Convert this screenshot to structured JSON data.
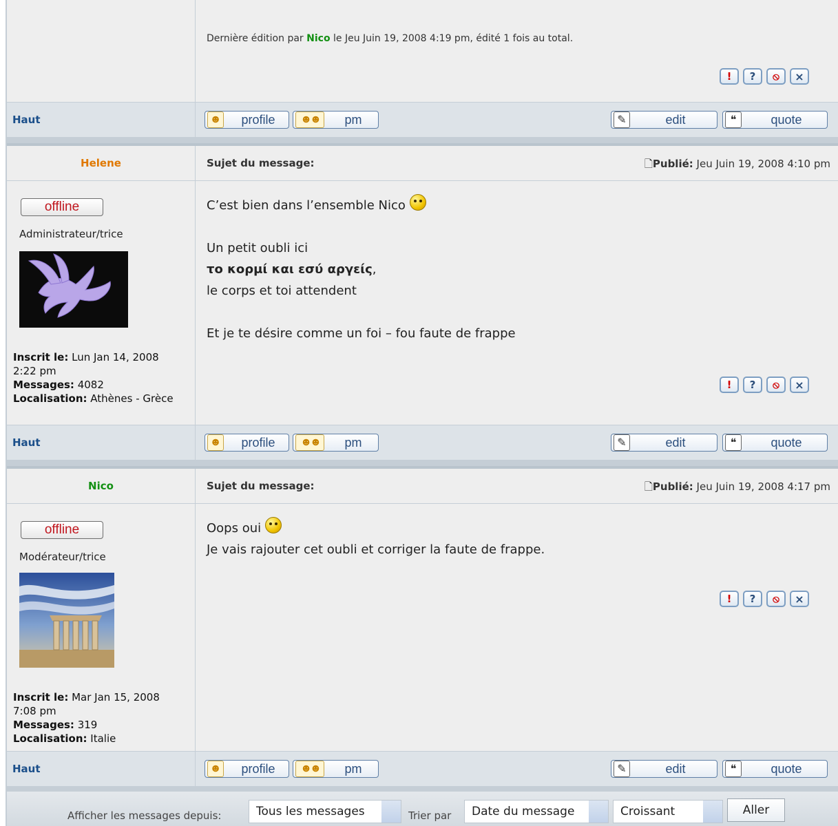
{
  "edit_note": {
    "prefix": "Dernière édition par",
    "author": "Nico",
    "suffix": "le Jeu Juin 19, 2008 4:19 pm, édité 1 fois au total."
  },
  "common": {
    "haut": "Haut",
    "subject_label": "Sujet du message:",
    "published_label": "Publié:",
    "offline_label": "offline",
    "profile_label": "profile",
    "pm_label": "pm",
    "edit_label": "edit",
    "quote_label": "quote",
    "registered_label": "Inscrit le:",
    "messages_label": "Messages:",
    "location_label": "Localisation:"
  },
  "posts": [
    {
      "author": "Helene",
      "author_color": "#e07800",
      "date": "Jeu Juin 19, 2008 4:10 pm",
      "rank": "Administrateur/trice",
      "registered": "Lun Jan 14, 2008 2:22 pm",
      "messages": "4082",
      "location": "Athènes - Grèce",
      "body": {
        "line1": "C’est bien dans l’ensemble Nico",
        "line2": "Un petit oubli ici",
        "line3_bold": "το κορμί και εσύ αργείς",
        "line3_rest": ",",
        "line4": "le corps et toi attendent",
        "line5": "Et je te désire comme un foi – fou faute de frappe"
      }
    },
    {
      "author": "Nico",
      "author_color": "#139013",
      "date": "Jeu Juin 19, 2008 4:17 pm",
      "rank": "Modérateur/trice",
      "registered": "Mar Jan 15, 2008 7:08 pm",
      "messages": "319",
      "location": "Italie",
      "body": {
        "line1": "Oops oui",
        "line2": "Je vais rajouter cet oubli et corriger la faute de frappe."
      }
    }
  ],
  "footer": {
    "show_label": "Afficher les messages depuis:",
    "show_value": "Tous les messages",
    "sort_label": "Trier par",
    "sort_value": "Date du message",
    "order_value": "Croissant",
    "go_label": "Aller"
  },
  "icons": [
    "warning-icon",
    "help-icon",
    "ban-icon",
    "delete-icon"
  ]
}
